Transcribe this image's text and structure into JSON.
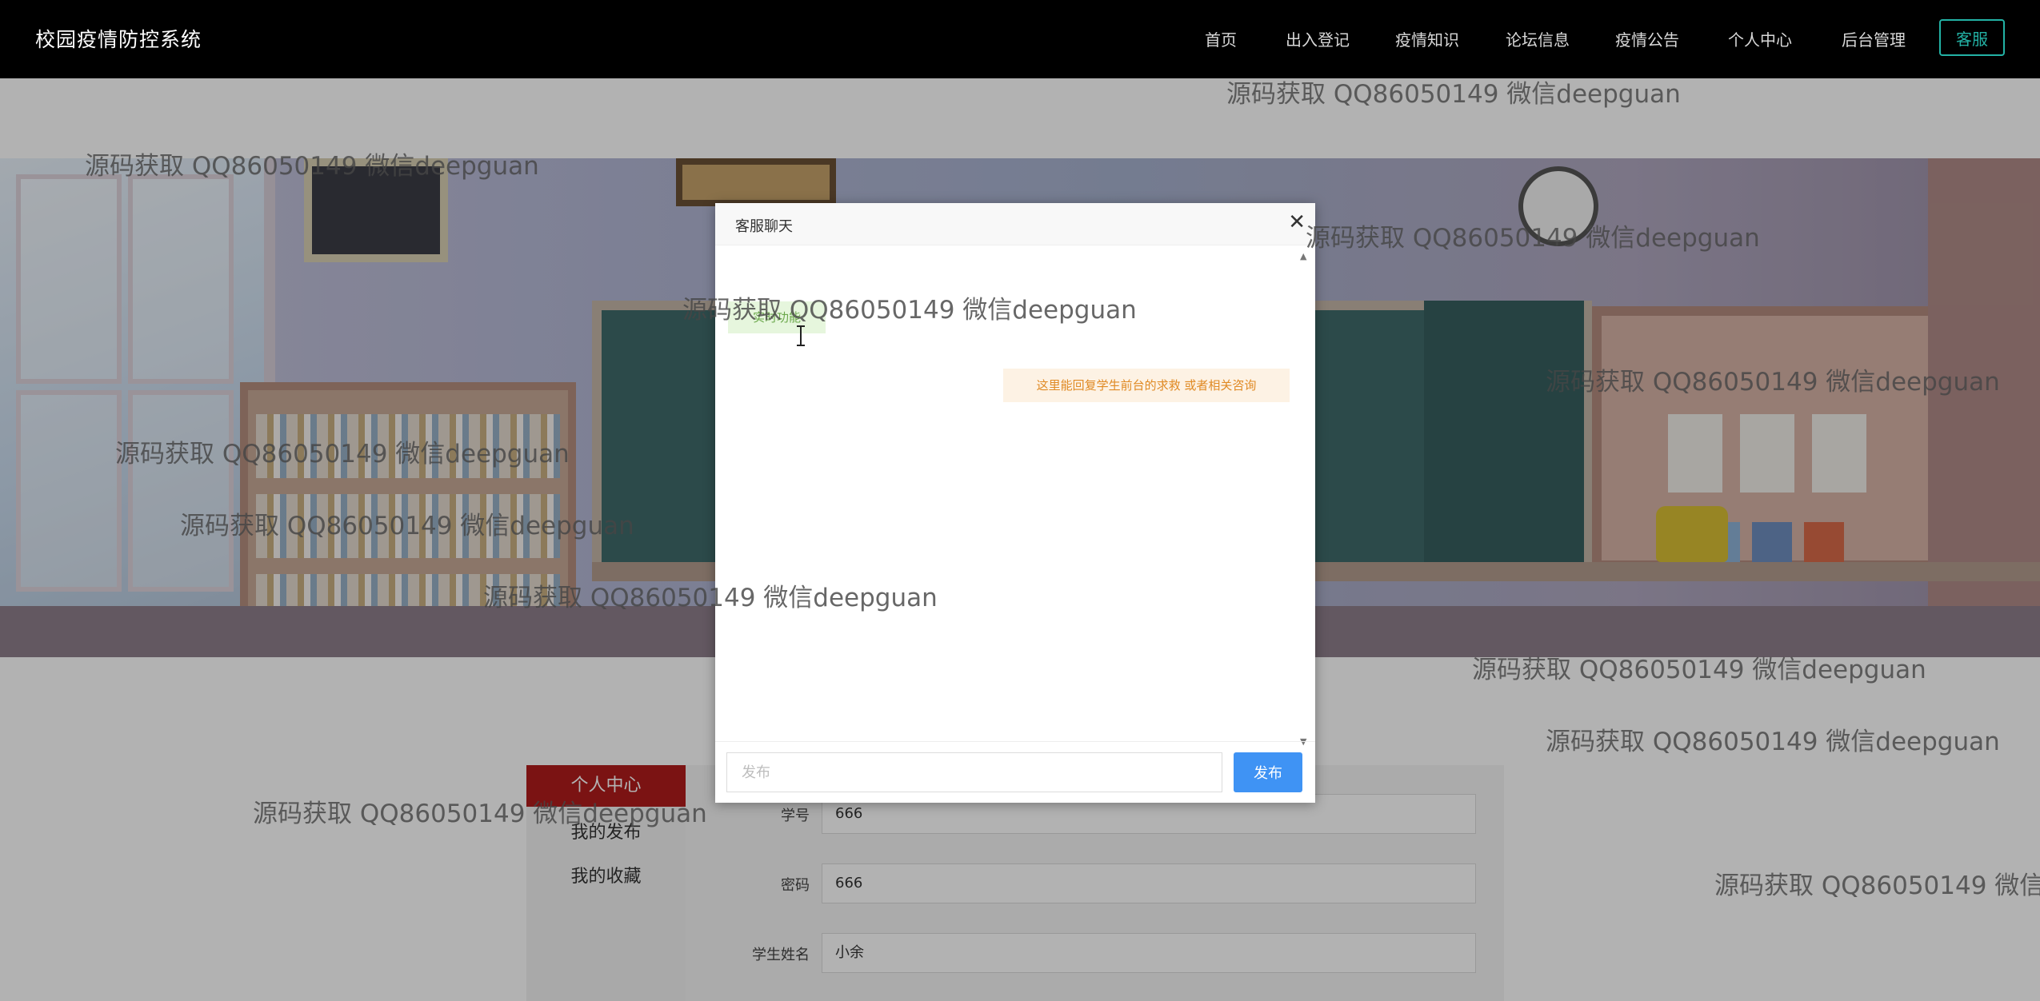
{
  "app": {
    "brand": "校园疫情防控系统"
  },
  "nav": {
    "items": [
      "首页",
      "出入登记",
      "疫情知识",
      "论坛信息",
      "疫情公告",
      "个人中心",
      "后台管理"
    ],
    "cta": "客服"
  },
  "profile": {
    "menu_title": "个人中心",
    "menu_items": [
      "我的发布",
      "我的收藏"
    ],
    "fields": [
      {
        "label": "学号",
        "value": "666"
      },
      {
        "label": "密码",
        "value": "666"
      },
      {
        "label": "学生姓名",
        "value": "小余"
      }
    ]
  },
  "chat": {
    "title": "客服聊天",
    "close_glyph": "✕",
    "messages": [
      {
        "side": "left",
        "text": "实时功能"
      },
      {
        "side": "right",
        "text": "这里能回复学生前台的求救 或者相关咨询"
      }
    ],
    "input_placeholder": "发布",
    "send_label": "发布",
    "scroll_up_glyph": "▲",
    "scroll_down_glyph": "▼"
  },
  "watermark": {
    "text": "源码获取 QQ86050149 微信deepguan",
    "text_cut": "源码获取 QQ86050149 微信d"
  },
  "icons": {
    "close": "close-icon",
    "cursor": "text-cursor-icon",
    "scroll": "scrollbar-arrow-icon"
  },
  "colors": {
    "topbar": "#000000",
    "cta_accent": "#23b2a5",
    "menu_head": "#b11c1c",
    "send_button": "#3f93f4",
    "bubble_left_bg": "#e6f6dd",
    "bubble_right_bg": "#fdf2e4"
  }
}
